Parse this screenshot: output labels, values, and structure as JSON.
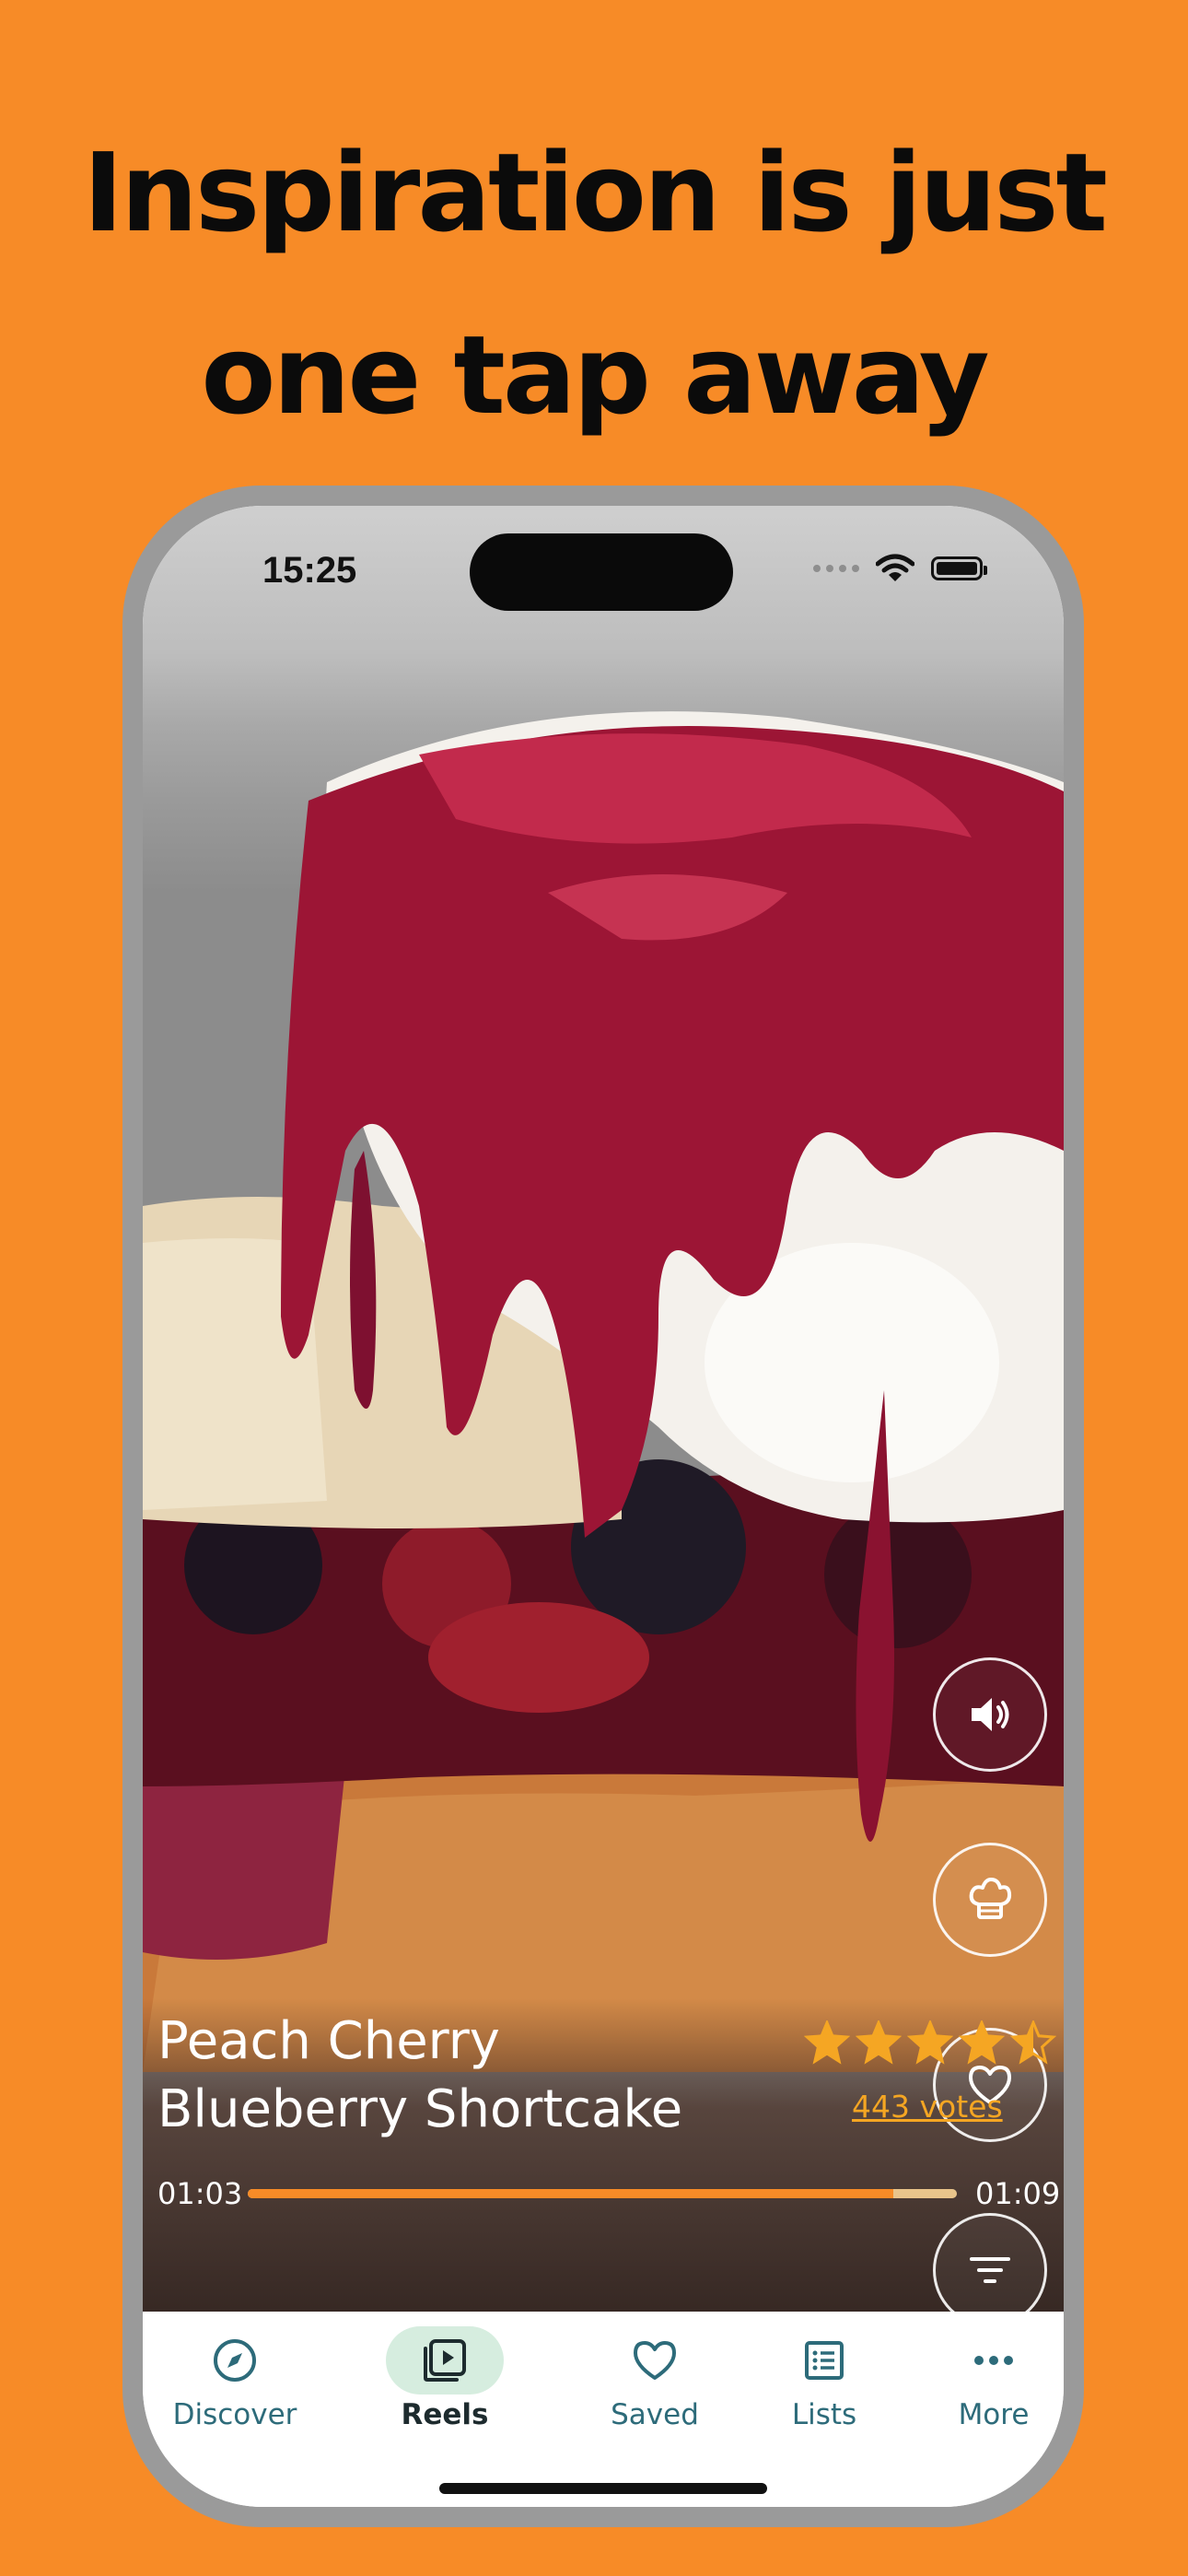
{
  "headline": {
    "line1": "Inspiration is just",
    "line2": "one tap away"
  },
  "status_bar": {
    "time": "15:25"
  },
  "side_actions": [
    {
      "name": "sound-button",
      "icon": "speaker-icon"
    },
    {
      "name": "chef-button",
      "icon": "chef-hat-icon"
    },
    {
      "name": "favorite-button",
      "icon": "heart-icon"
    },
    {
      "name": "filter-button",
      "icon": "filter-icon"
    }
  ],
  "recipe": {
    "title_line1": "Peach Cherry",
    "title_line2": "Blueberry Shortcake",
    "rating": 4.5,
    "rating_max": 5,
    "votes": "443 votes"
  },
  "player": {
    "elapsed": "01:03",
    "total": "01:09",
    "progress": 0.91,
    "buffered": 1.0
  },
  "tabs": [
    {
      "label": "Discover",
      "icon": "compass-icon",
      "active": false
    },
    {
      "label": "Reels",
      "icon": "play-reels-icon",
      "active": true
    },
    {
      "label": "Saved",
      "icon": "heart-icon",
      "active": false
    },
    {
      "label": "Lists",
      "icon": "list-icon",
      "active": false
    },
    {
      "label": "More",
      "icon": "more-dots-icon",
      "active": false
    }
  ],
  "colors": {
    "background": "#F78B27",
    "accent": "#F78B27",
    "star": "#F5A623",
    "tab_text": "#2d6b7a",
    "active_pill": "#d6eddf"
  }
}
